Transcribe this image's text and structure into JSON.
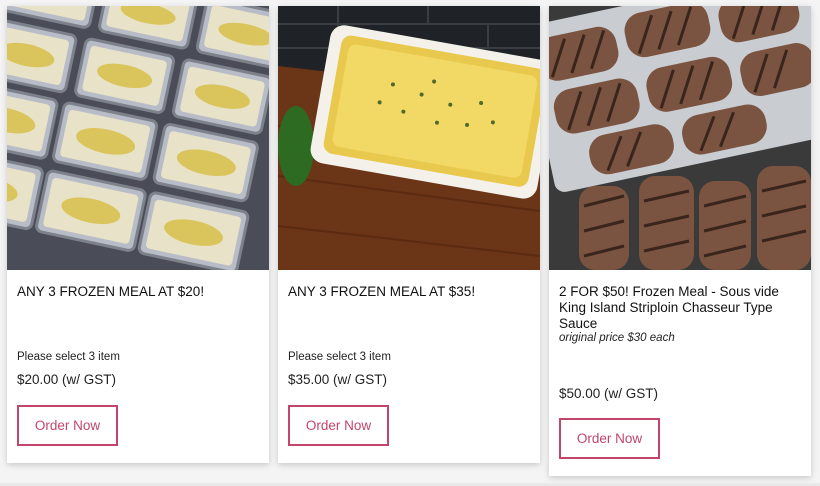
{
  "products": [
    {
      "title": "ANY 3 FROZEN MEAL AT $20!",
      "note": "Please select 3 item",
      "price": "$20.00 (w/ GST)",
      "button": "Order Now",
      "image": "foil trays of creamy pasta with cheese"
    },
    {
      "title": "ANY 3 FROZEN MEAL AT $35!",
      "note": "Please select 3 item",
      "price": "$35.00 (w/ GST)",
      "button": "Order Now",
      "image": "baked lasagna tray on wooden board"
    },
    {
      "title": "2 FOR $50! Frozen Meal - Sous vide King Island Striploin Chasseur Type Sauce",
      "subtitle": "original price $30 each",
      "price": "$50.00 (w/ GST)",
      "button": "Order Now",
      "image": "grilled striploin steaks on a rack"
    }
  ],
  "colors": {
    "accent": "#c2456c",
    "card": "#ffffff",
    "background": "#f4f4f4"
  }
}
